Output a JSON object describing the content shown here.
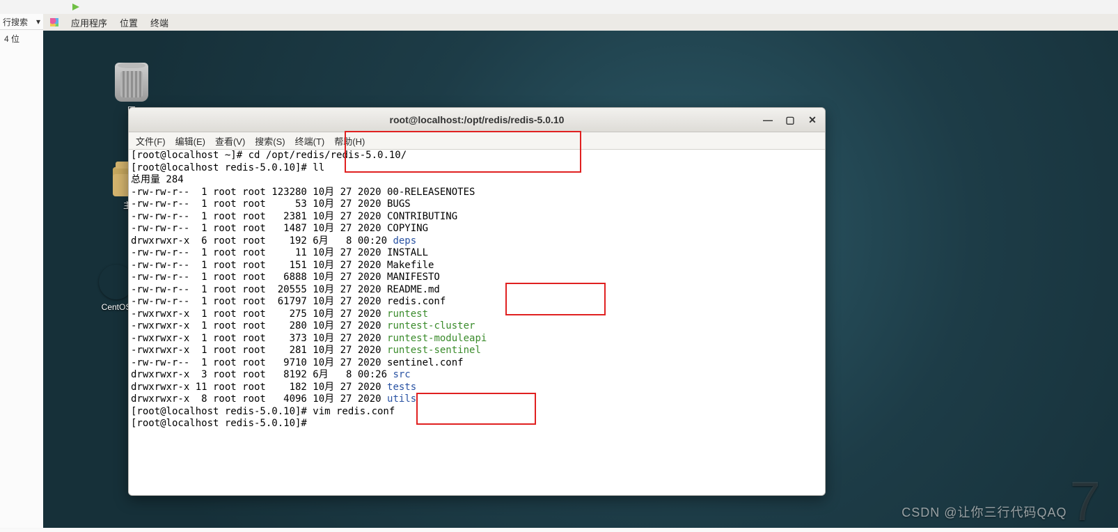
{
  "host": {
    "toolbar_search": "行搜索",
    "toolbar_dropdown_icon": "▾",
    "left_pane_unit": "4 位"
  },
  "vm_menu": {
    "applications": "应用程序",
    "places": "位置",
    "terminal": "终端"
  },
  "desktop_icons": {
    "trash": "回",
    "home": "主文",
    "cd": "CentOS"
  },
  "terminal": {
    "title": "root@localhost:/opt/redis/redis-5.0.10",
    "menus": {
      "file": "文件(F)",
      "edit": "编辑(E)",
      "view": "查看(V)",
      "search": "搜索(S)",
      "terminal": "终端(T)",
      "help": "帮助(H)"
    },
    "lines": {
      "l1a": "[root@localhost ~]# ",
      "l1b": "cd /opt/redis/redis-5.0.10/",
      "l2": "[root@localhost redis-5.0.10]# ll",
      "l3": "总用量 284",
      "l4": "-rw-rw-r--  1 root root 123280 10月 27 2020 00-RELEASENOTES",
      "l5": "-rw-rw-r--  1 root root     53 10月 27 2020 BUGS",
      "l6": "-rw-rw-r--  1 root root   2381 10月 27 2020 CONTRIBUTING",
      "l7": "-rw-rw-r--  1 root root   1487 10月 27 2020 COPYING",
      "l8a": "drwxrwxr-x  6 root root    192 6月   8 00:20 ",
      "l8b": "deps",
      "l9": "-rw-rw-r--  1 root root     11 10月 27 2020 INSTALL",
      "l10": "-rw-rw-r--  1 root root    151 10月 27 2020 Makefile",
      "l11": "-rw-rw-r--  1 root root   6888 10月 27 2020 MANIFESTO",
      "l12": "-rw-rw-r--  1 root root  20555 10月 27 2020 README.md",
      "l13": "-rw-rw-r--  1 root root  61797 10月 27 2020 redis.conf",
      "l14a": "-rwxrwxr-x  1 root root    275 10月 27 2020 ",
      "l14b": "runtest",
      "l15a": "-rwxrwxr-x  1 root root    280 10月 27 2020 ",
      "l15b": "runtest-cluster",
      "l16a": "-rwxrwxr-x  1 root root    373 10月 27 2020 ",
      "l16b": "runtest-moduleapi",
      "l17a": "-rwxrwxr-x  1 root root    281 10月 27 2020 ",
      "l17b": "runtest-sentinel",
      "l18": "-rw-rw-r--  1 root root   9710 10月 27 2020 sentinel.conf",
      "l19a": "drwxrwxr-x  3 root root   8192 6月   8 00:26 ",
      "l19b": "src",
      "l20a": "drwxrwxr-x 11 root root    182 10月 27 2020 ",
      "l20b": "tests",
      "l21a": "drwxrwxr-x  8 root root   4096 10月 27 2020 ",
      "l21b": "utils",
      "l22": "[root@localhost redis-5.0.10]# vim redis.conf",
      "l23": "[root@localhost redis-5.0.10]# "
    }
  },
  "watermark": "CSDN @让你三行代码QAQ"
}
